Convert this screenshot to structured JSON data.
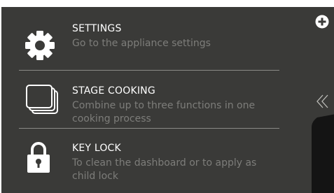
{
  "menu": {
    "items": [
      {
        "title": "SETTINGS",
        "description": "Go to the appliance settings",
        "icon": "gear-icon"
      },
      {
        "title": "STAGE COOKING",
        "description": "Combine up to three functions in one cooking process",
        "icon": "stacked-cards-icon"
      },
      {
        "title": "KEY LOCK",
        "description": "To clean the dashboard or to apply as child lock",
        "icon": "padlock-icon"
      }
    ]
  },
  "sidebar": {
    "plus_icon": "plus-circle-icon",
    "back_icon": "double-chevron-left-icon"
  },
  "colors": {
    "background": "#3a3a38",
    "title_text": "#ffffff",
    "description_text": "#7d7d7a",
    "divider": "#8a8a86",
    "side_panel": "#141414"
  }
}
